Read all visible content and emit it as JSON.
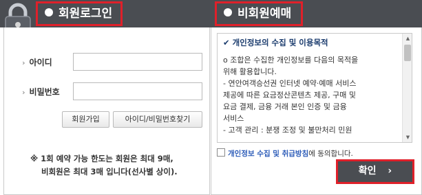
{
  "tabs": {
    "login": "회원로그인",
    "guest": "비회원예매"
  },
  "login_form": {
    "id_label": "아이디",
    "id_value": "",
    "password_label": "비밀번호",
    "password_value": "",
    "signup_button": "회원가입",
    "find_button": "아이디/비밀번호찾기",
    "notice_line1": "※ 1회 예약 가능 한도는 회원은 최대 9매,",
    "notice_line2": "비회원은 최대 3매 입니다(선사별 상이)."
  },
  "terms": {
    "title": "개인정보의 수집 및 이용목적",
    "body_lines": [
      "o 조합은 수집한 개인정보를 다음의 목적을",
      "위해 활용합니다.",
      "- 연안여객승선권 인터넷 예약·예매 서비스",
      "제공에 따른 요금정산콘텐츠 제공, 구매 및",
      "요금 결제, 금융 거래 본인 인증 및 금융",
      "서비스",
      "- 고객 관리 : 분쟁 조정 및 불만처리 민원"
    ]
  },
  "agreement": {
    "checked": false,
    "link_text": "개인정보 수집 및 취급방침",
    "suffix_text": "에 동의합니다."
  },
  "confirm_button": "확인",
  "colors": {
    "header_bg": "#4a4d52",
    "highlight_red": "#e0202a",
    "link_blue": "#2b5bb8"
  }
}
